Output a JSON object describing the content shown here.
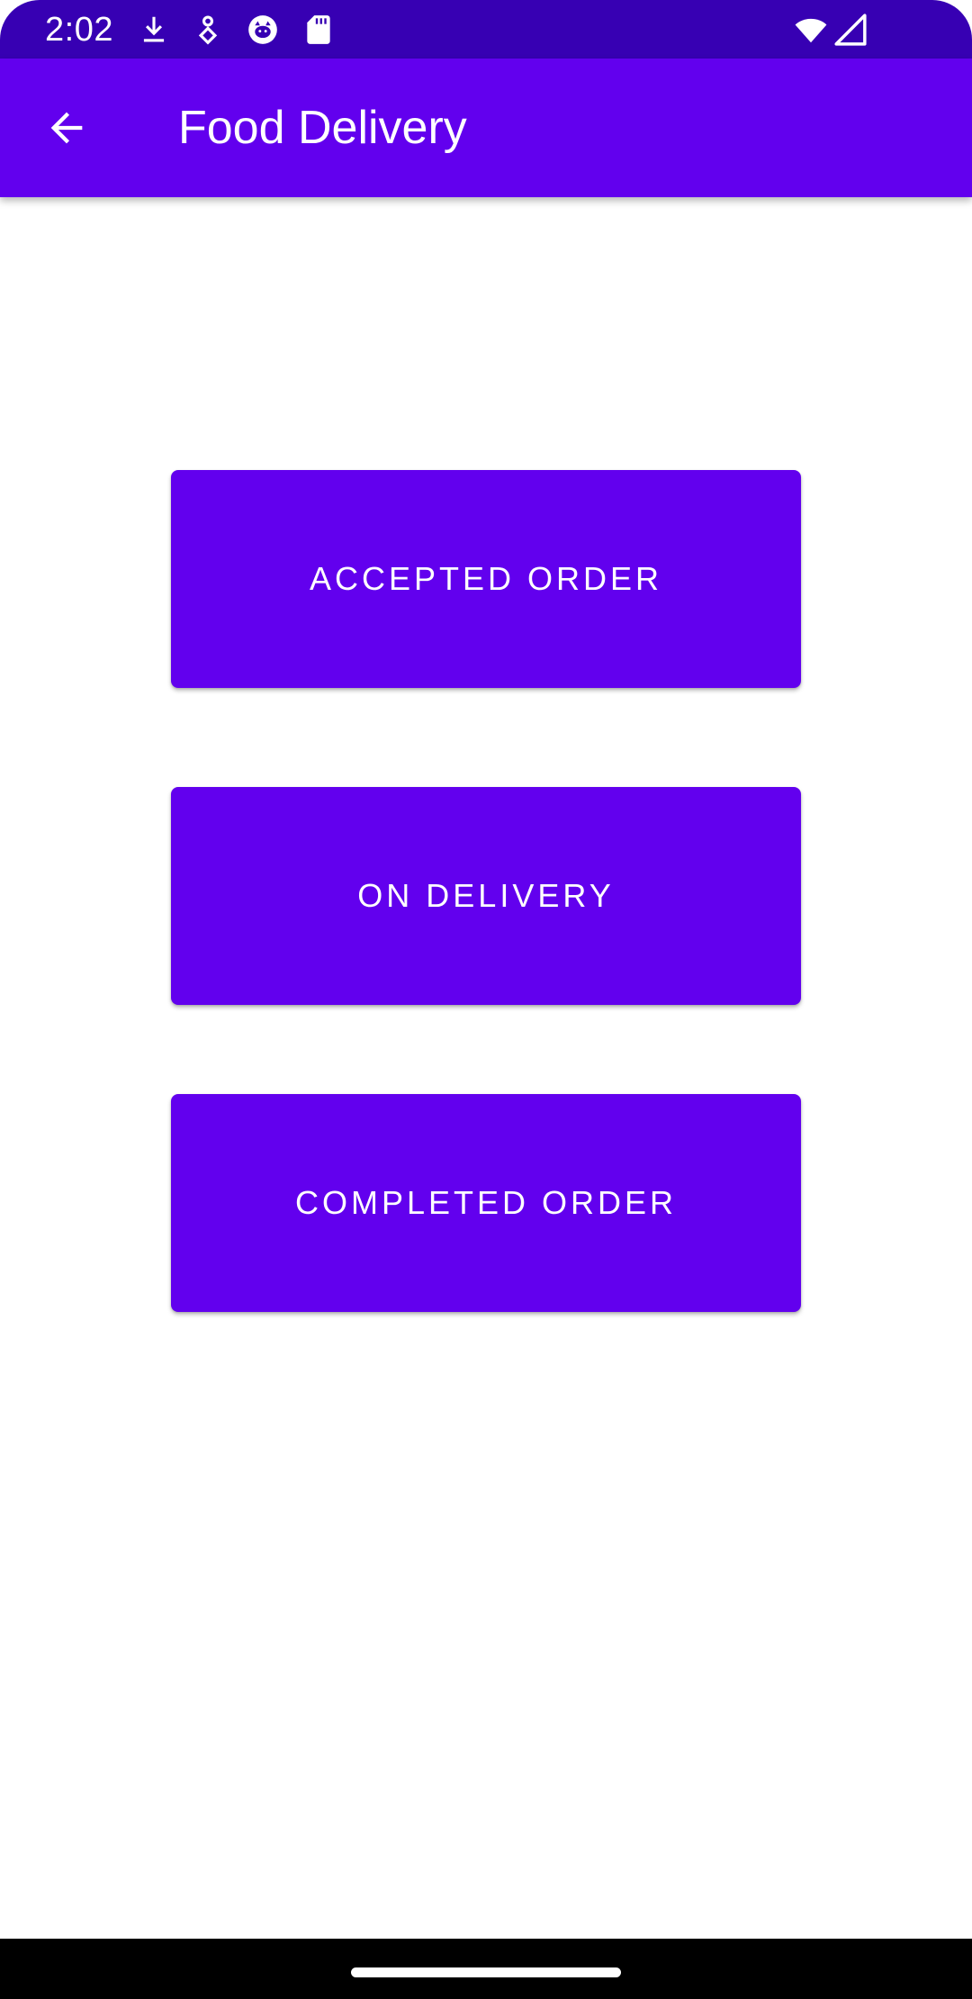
{
  "status_bar": {
    "time": "2:02",
    "left_icons": [
      "download-icon",
      "accessibility-icon",
      "cat-app-icon",
      "sd-card-icon"
    ],
    "right_icons": [
      "wifi-icon",
      "cell-signal-icon"
    ],
    "background_color": "#3700b3"
  },
  "app_bar": {
    "title": "Food Delivery",
    "back_icon": "arrow-back-icon",
    "background_color": "#6200ee"
  },
  "buttons": {
    "accepted_order": "ACCEPTED ORDER",
    "on_delivery": "ON DELIVERY",
    "completed_order": "COMPLETED ORDER",
    "color": "#6200ee",
    "text_color": "#ffffff"
  },
  "nav_bar": {
    "handle_icon": "home-gesture-handle"
  }
}
